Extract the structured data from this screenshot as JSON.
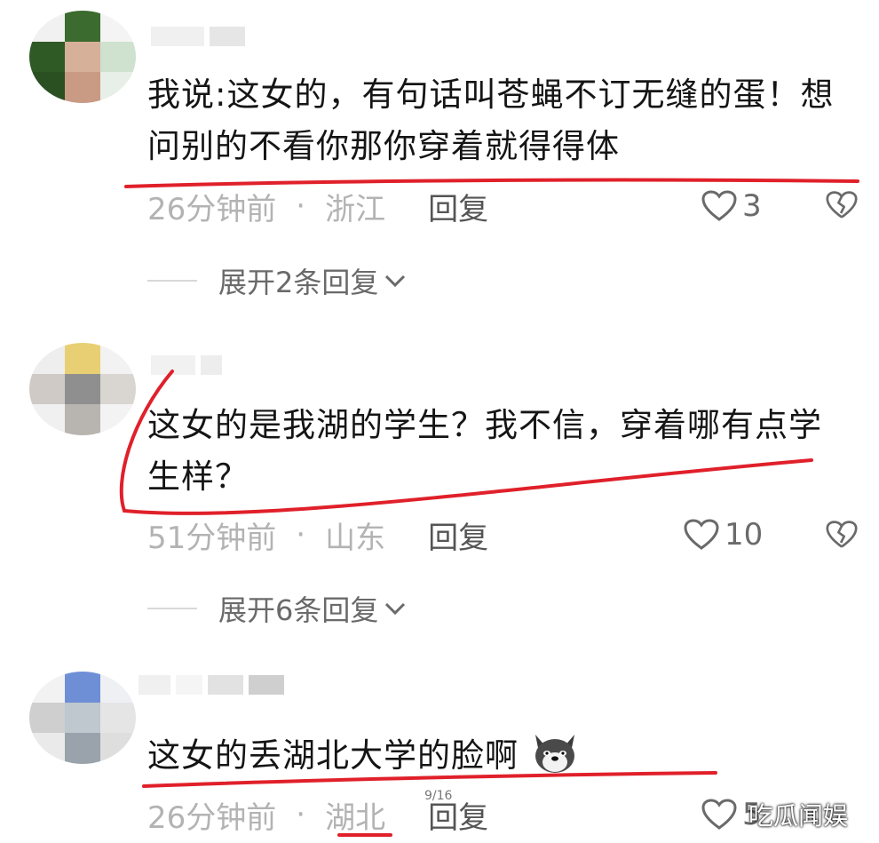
{
  "comments": [
    {
      "text": "我说:这女的，有句话叫苍蝇不订无缝的蛋！想问别的不看你那你穿着就得得体",
      "time": "26分钟前",
      "location": "浙江",
      "reply_label": "回复",
      "likes": "3",
      "expand_label": "展开2条回复"
    },
    {
      "text": "这女的是我湖的学生？我不信，穿着哪有点学生样？",
      "time": "51分钟前",
      "location": "山东",
      "reply_label": "回复",
      "likes": "10",
      "expand_label": "展开6条回复"
    },
    {
      "text": "这女的丢湖北大学的脸啊",
      "time": "26分钟前",
      "location": "湖北",
      "reply_label": "回复",
      "likes": "5"
    }
  ],
  "separator": "·",
  "page_indicator": "9/16",
  "watermark": "吃瓜闻娱",
  "colors": {
    "annotation": "#e0202a",
    "meta": "#b3b3b3",
    "text": "#151515"
  },
  "icons": {
    "like": "heart-outline-icon",
    "dislike": "broken-heart-icon",
    "expand": "chevron-down-icon",
    "emoji": "dog-face-emoji"
  }
}
